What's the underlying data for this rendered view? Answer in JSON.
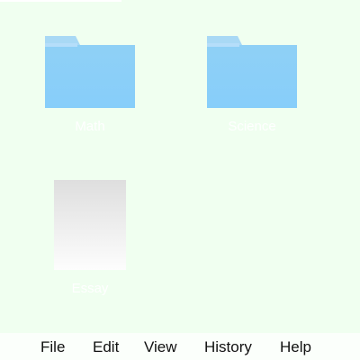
{
  "desktop": {
    "items": [
      {
        "type": "folder",
        "label": "Math"
      },
      {
        "type": "folder",
        "label": "Science"
      },
      {
        "type": "document",
        "label": "Essay"
      }
    ]
  },
  "menubar": {
    "items": [
      {
        "label": "File"
      },
      {
        "label": "Edit"
      },
      {
        "label": "View"
      },
      {
        "label": "History"
      },
      {
        "label": "Help"
      }
    ]
  },
  "colors": {
    "desktop_background": "#f0fff0",
    "folder": "#87cefa",
    "label_text": "#ffffff",
    "menu_text": "#111111"
  }
}
